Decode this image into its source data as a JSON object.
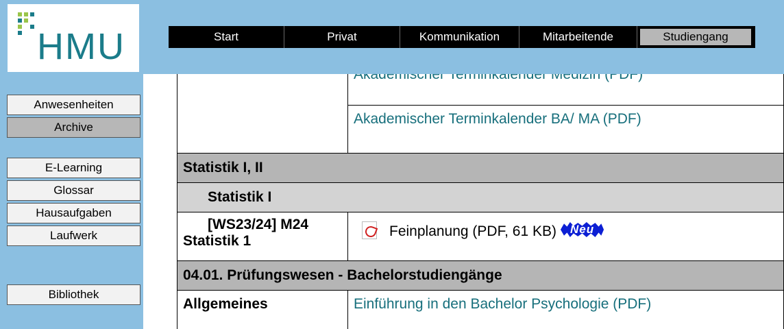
{
  "logo": {
    "text": "HMU"
  },
  "colors": {
    "background": "#8bbfe1",
    "link": "#176f7c",
    "accent_logo": "#1b7c8a",
    "badge": "#0c1fd4"
  },
  "topnav": [
    {
      "label": "Start"
    },
    {
      "label": "Privat"
    },
    {
      "label": "Kommunikation"
    },
    {
      "label": "Mitarbeitende"
    },
    {
      "label": "Studiengang",
      "active": true
    }
  ],
  "sidebar": {
    "items": [
      {
        "label": "Anwesenheiten"
      },
      {
        "label": "Archive",
        "active": true
      },
      {
        "label": "E-Learning"
      },
      {
        "label": "Glossar"
      },
      {
        "label": "Hausaufgaben"
      },
      {
        "label": "Laufwerk"
      },
      {
        "label": "Bibliothek"
      }
    ]
  },
  "content": {
    "row_cut_link": "Akademischer Terminkalender Medizin (PDF)",
    "row_ba_link": "Akademischer Terminkalender BA/ MA (PDF)",
    "section_statistik": "Statistik I, II",
    "subsection_statistik1": "Statistik I",
    "course_label": "[WS23/24] M24 Statistik 1",
    "course_file": "Feinplanung (PDF, 61 KB)",
    "course_badge": "Neu",
    "section_pruefung": "04.01. Prüfungswesen - Bachelorstudiengänge",
    "allgemeines_label": "Allgemeines",
    "allgemeines_link": "Einführung in den Bachelor Psychologie (PDF)"
  }
}
